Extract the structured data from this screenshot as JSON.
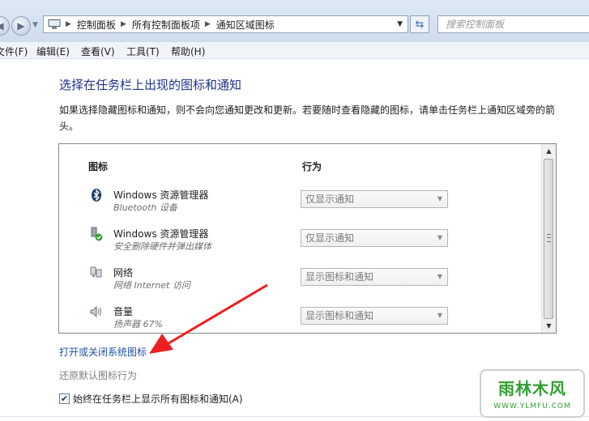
{
  "address_bar": {
    "breadcrumbs": [
      "控制面板",
      "所有控制面板项",
      "通知区域图标"
    ],
    "search_placeholder": "搜索控制面板"
  },
  "menu": {
    "items": [
      "文件(F)",
      "编辑(E)",
      "查看(V)",
      "工具(T)",
      "帮助(H)"
    ]
  },
  "main": {
    "heading": "选择在任务栏上出现的图标和通知",
    "description": "如果选择隐藏图标和通知，则不会向您通知更改和更新。若要随时查看隐藏的图标，请单击任务栏上通知区域旁的箭头。",
    "table": {
      "col_icon": "图标",
      "col_behavior": "行为",
      "rows": [
        {
          "icon": "bluetooth-icon",
          "name": "Windows 资源管理器",
          "sub": "Bluetooth 设备",
          "behavior": "仅显示通知"
        },
        {
          "icon": "safe-remove-hardware-icon",
          "name": "Windows 资源管理器",
          "sub": "安全删除硬件并弹出媒体",
          "behavior": "仅显示通知"
        },
        {
          "icon": "network-icon",
          "name": "网络",
          "sub": "网络 Internet 访问",
          "behavior": "显示图标和通知"
        },
        {
          "icon": "speaker-icon",
          "name": "音量",
          "sub": "扬声器 67%",
          "behavior": "显示图标和通知"
        }
      ]
    },
    "link_system_icons": "打开或关闭系统图标",
    "link_restore": "还原默认图标行为",
    "checkbox_label": "始终在任务栏上显示所有图标和通知(A)",
    "checkbox_checked": true
  },
  "watermark": {
    "title": "雨林木风",
    "url": "WWW.YLMFU.COM"
  }
}
